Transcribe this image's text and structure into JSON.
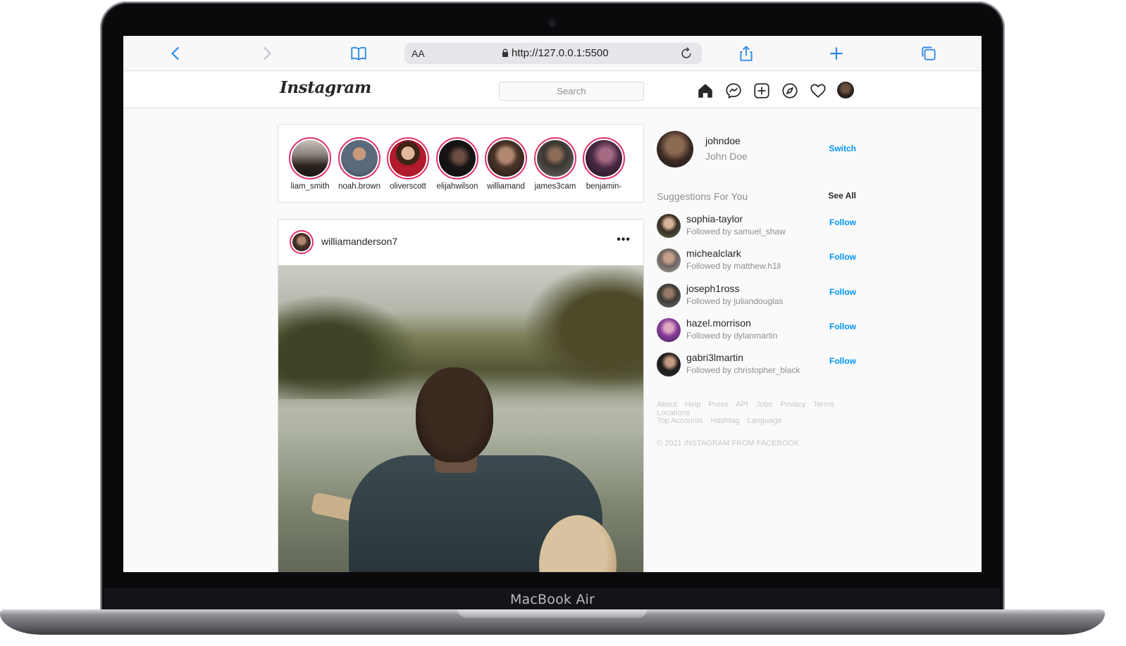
{
  "device": {
    "label": "MacBook Air"
  },
  "browser": {
    "reader_label": "AA",
    "url": "http://127.0.0.1:5500",
    "accent": "#2d89e6"
  },
  "nav": {
    "logo": "Instagram",
    "search_placeholder": "Search",
    "icons": [
      "home-icon",
      "messenger-icon",
      "new-post-icon",
      "explore-icon",
      "activity-heart-icon",
      "profile-avatar"
    ]
  },
  "stories": [
    {
      "username": "liam_smith"
    },
    {
      "username": "noah.brown"
    },
    {
      "username": "oliverscott"
    },
    {
      "username": "elijahwilson"
    },
    {
      "username": "williamand"
    },
    {
      "username": "james3cam"
    },
    {
      "username": "benjamin-"
    }
  ],
  "post": {
    "username": "williamanderson7",
    "more_label": "•••"
  },
  "sidebar": {
    "me": {
      "username": "johndoe",
      "full_name": "John Doe",
      "switch_label": "Switch"
    },
    "suggestions_title": "Suggestions For You",
    "see_all_label": "See All",
    "follow_label": "Follow",
    "suggestions": [
      {
        "username": "sophia-taylor",
        "followed_by": "Followed by samuel_shaw"
      },
      {
        "username": "michealclark",
        "followed_by": "Followed by matthew.h1ll"
      },
      {
        "username": "joseph1ross",
        "followed_by": "Followed by juliandouglas"
      },
      {
        "username": "hazel.morrison",
        "followed_by": "Followed by dylanmartin"
      },
      {
        "username": "gabri3lmartin",
        "followed_by": "Followed by christopher_black"
      }
    ],
    "footer_links_row1": [
      "About",
      "Help",
      "Press",
      "API",
      "Jobs",
      "Privacy",
      "Terms",
      "Locations"
    ],
    "footer_links_row2": [
      "Top Accounts",
      "Hashtag",
      "Language"
    ],
    "copyright": "© 2021 INSTAGRAM FROM FACEBOOK"
  },
  "colors": {
    "story_ring": "#e1306c",
    "link_blue": "#0095f6",
    "text_primary": "#262626",
    "text_secondary": "#8e8e8e"
  }
}
